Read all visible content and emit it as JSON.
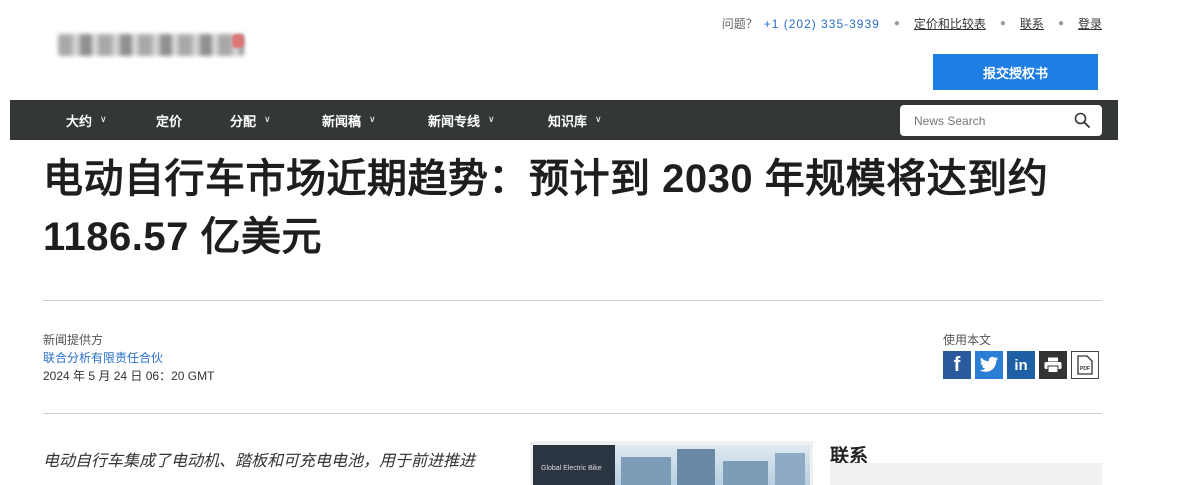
{
  "topbar": {
    "question": "问题？",
    "phone": "+1 (202) 335-3939",
    "pricing_link": "定价和比较表",
    "contact_link": "联系",
    "login_link": "登录"
  },
  "submit_button": "报交授权书",
  "nav": {
    "items": [
      {
        "label": "大约",
        "has_dropdown": true
      },
      {
        "label": "定价",
        "has_dropdown": false
      },
      {
        "label": "分配",
        "has_dropdown": true
      },
      {
        "label": "新闻稿",
        "has_dropdown": true
      },
      {
        "label": "新闻专线",
        "has_dropdown": true
      },
      {
        "label": "知识库",
        "has_dropdown": true
      }
    ],
    "search_placeholder": "News Search"
  },
  "article": {
    "title": "电动自行车市场近期趋势：预计到 2030 年规模将达到约 1186.57 亿美元",
    "provider_label": "新闻提供方",
    "provider_name": "联合分析有限责任合伙",
    "date": "2024 年 5 月 24 日 06：20 GMT",
    "share_label": "使用本文",
    "lead": "电动自行车集成了电动机、踏板和可充电电池，用于前进推进",
    "thumb_text": "Global Electric Bike"
  },
  "sidebar": {
    "contact_heading": "联系"
  },
  "colors": {
    "nav_bg": "#333738",
    "accent_blue": "#1e7ee4",
    "link_blue": "#2a6fc9"
  },
  "icons": [
    "facebook-icon",
    "twitter-icon",
    "linkedin-icon",
    "print-icon",
    "pdf-icon",
    "search-icon",
    "chevron-down-icon"
  ]
}
